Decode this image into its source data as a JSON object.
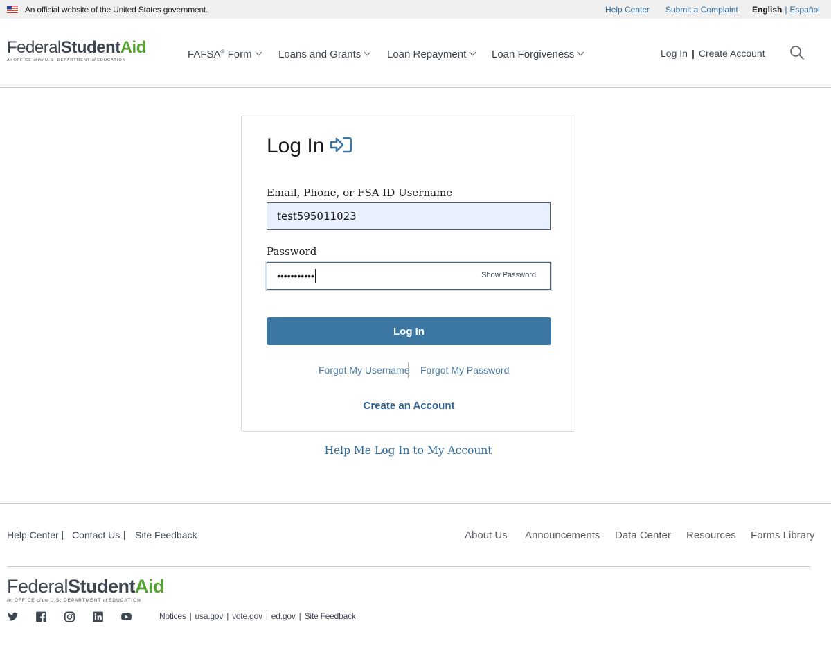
{
  "gov_banner": {
    "text": "An official website of the United States government.",
    "help_center": "Help Center",
    "submit_complaint": "Submit a Complaint",
    "lang_active": "English",
    "lang_separator": "|",
    "lang_other": "Español"
  },
  "logo": {
    "word1": "Federal",
    "word2": "Student",
    "word3": "Aid",
    "sub_a": "An",
    "sub_b": "OFFICE",
    "sub_c": "of the",
    "sub_d": "U.S. DEPARTMENT",
    "sub_e": "of",
    "sub_f": "EDUCATION"
  },
  "nav": {
    "fafsa": "FAFSA",
    "fafsa_mark": "®",
    "fafsa_suffix": " Form",
    "loans_grants": "Loans and Grants",
    "loan_repayment": "Loan Repayment",
    "loan_forgiveness": "Loan Forgiveness",
    "log_in": "Log In",
    "separator": "|",
    "create_account": "Create Account"
  },
  "login": {
    "title": "Log In",
    "username_label": "Email, Phone, or FSA ID Username",
    "username_value": "test595011023",
    "password_label": "Password",
    "password_masked": "•••••••••••",
    "show_password": "Show Password",
    "submit": "Log In",
    "forgot_username": "Forgot My Username",
    "forgot_password": "Forgot My Password",
    "create_account": "Create an Account"
  },
  "help_link": "Help Me Log In to My Account",
  "footer": {
    "left_links": [
      "Help Center",
      "Contact Us",
      "Site Feedback"
    ],
    "left_separator": "|",
    "right_links": [
      "About Us",
      "Announcements",
      "Data Center",
      "Resources",
      "Forms Library"
    ],
    "bottom_links": [
      "Notices",
      "usa.gov",
      "vote.gov",
      "ed.gov",
      "Site Feedback"
    ],
    "bottom_separator": "|",
    "social_icons": [
      "twitter-icon",
      "facebook-icon",
      "instagram-icon",
      "linkedin-icon",
      "youtube-icon"
    ]
  },
  "colors": {
    "primary_button": "#3c76a2",
    "link": "#2e6d9f",
    "logo_green": "#56a333",
    "logo_gray": "#3d4551",
    "autofill_bg": "#e8f0fe"
  }
}
